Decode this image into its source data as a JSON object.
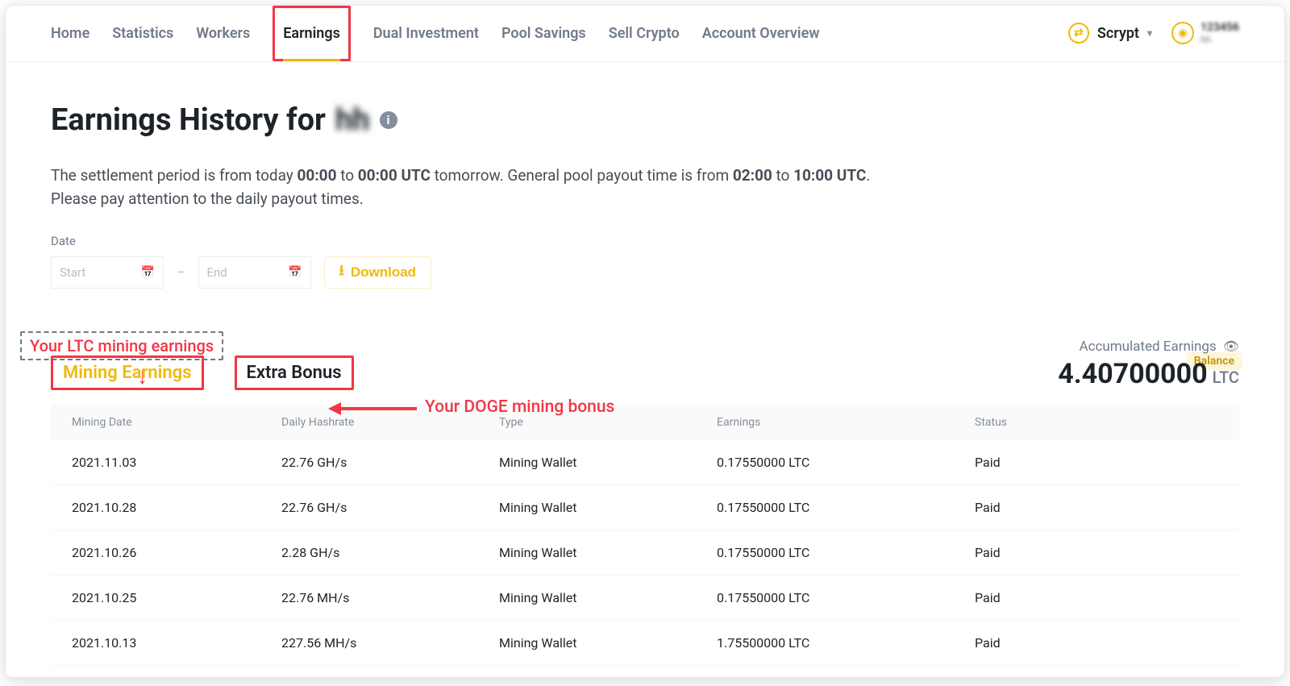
{
  "nav": {
    "items": [
      "Home",
      "Statistics",
      "Workers",
      "Earnings",
      "Dual Investment",
      "Pool Savings",
      "Sell Crypto",
      "Account Overview"
    ],
    "active_index": 3,
    "algo": "Scrypt",
    "user_top": "123456",
    "user_bottom": "hh"
  },
  "page": {
    "title_prefix": "Earnings History for ",
    "title_subject": "hh",
    "subtext_line1_a": "The settlement period is from today ",
    "subtext_time1": "00:00",
    "subtext_between": " to ",
    "subtext_time2": "00:00 UTC",
    "subtext_line1_b": " tomorrow. General pool payout time is from ",
    "subtext_time3": "02:00",
    "subtext_to": " to ",
    "subtext_time4": "10:00 UTC",
    "subtext_line2": "Please pay attention to the daily payout times.",
    "date_label": "Date",
    "start_placeholder": "Start",
    "end_placeholder": "End",
    "download_label": "Download",
    "balance_chip": "Balance"
  },
  "annotations": {
    "ltc_box": "Your LTC mining earnings",
    "doge_text": "Your DOGE mining bonus"
  },
  "subtabs": {
    "mining": "Mining Earnings",
    "extra": "Extra Bonus"
  },
  "accumulated": {
    "label": "Accumulated Earnings",
    "value": "4.40700000",
    "unit": "LTC"
  },
  "table": {
    "headers": [
      "Mining Date",
      "Daily Hashrate",
      "Type",
      "Earnings",
      "Status"
    ],
    "rows": [
      {
        "date": "2021.11.03",
        "hashrate": "22.76 GH/s",
        "type": "Mining Wallet",
        "earnings": "0.17550000 LTC",
        "status": "Paid"
      },
      {
        "date": "2021.10.28",
        "hashrate": "22.76 GH/s",
        "type": "Mining Wallet",
        "earnings": "0.17550000 LTC",
        "status": "Paid"
      },
      {
        "date": "2021.10.26",
        "hashrate": "2.28 GH/s",
        "type": "Mining Wallet",
        "earnings": "0.17550000 LTC",
        "status": "Paid"
      },
      {
        "date": "2021.10.25",
        "hashrate": "22.76 MH/s",
        "type": "Mining Wallet",
        "earnings": "0.17550000 LTC",
        "status": "Paid"
      },
      {
        "date": "2021.10.13",
        "hashrate": "227.56 MH/s",
        "type": "Mining Wallet",
        "earnings": "1.75500000 LTC",
        "status": "Paid"
      }
    ]
  }
}
